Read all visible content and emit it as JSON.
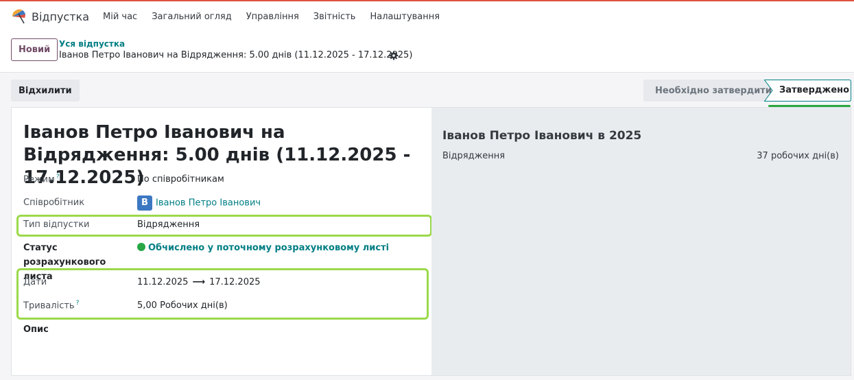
{
  "app": {
    "name": "Відпустка",
    "brand_color": "#714b67",
    "accent_color": "#017e84"
  },
  "nav": {
    "items": [
      "Мій час",
      "Загальний огляд",
      "Управління",
      "Звітність",
      "Налаштування"
    ]
  },
  "control_panel": {
    "new_button": "Новий",
    "breadcrumb_parent": "Уся відпустка",
    "breadcrumb_current": "Іванов Петро Іванович на Відрядження: 5.00 днів (11.12.2025 - 17.12.2025)",
    "settings_icon": "gear-icon"
  },
  "statusbar": {
    "refuse_button": "Відхилити",
    "stages": [
      {
        "label": "Необхідно затвердити",
        "active": false
      },
      {
        "label": "Затверджено",
        "active": true
      }
    ]
  },
  "form": {
    "title": "Іванов Петро Іванович на Відрядження: 5.00 днів (11.12.2025 - 17.12.2025)",
    "fields": {
      "mode": {
        "label": "Режим",
        "help": "?",
        "value": "По співробітникам"
      },
      "employee": {
        "label": "Співробітник",
        "avatar_letter": "В",
        "value": "Іванов Петро Іванович"
      },
      "leave_type": {
        "label": "Тип відпустки",
        "value": "Відрядження"
      },
      "payslip_status": {
        "label": "Статус розрахункового листа",
        "value": "Обчислено у поточному розрахунковому листі",
        "status_color": "#28a745"
      },
      "dates": {
        "label": "Дати",
        "from": "11.12.2025",
        "arrow": "⟶",
        "to": "17.12.2025"
      },
      "duration": {
        "label": "Тривалість",
        "help": "?",
        "value": "5,00 Робочих дні(в)"
      },
      "description": {
        "label": "Опис"
      }
    }
  },
  "aside": {
    "title": "Іванов Петро Іванович в 2025",
    "rows": [
      {
        "label": "Відрядження",
        "value": "37 робочих дні(в)"
      }
    ]
  },
  "highlight_color": "#9bd94a"
}
